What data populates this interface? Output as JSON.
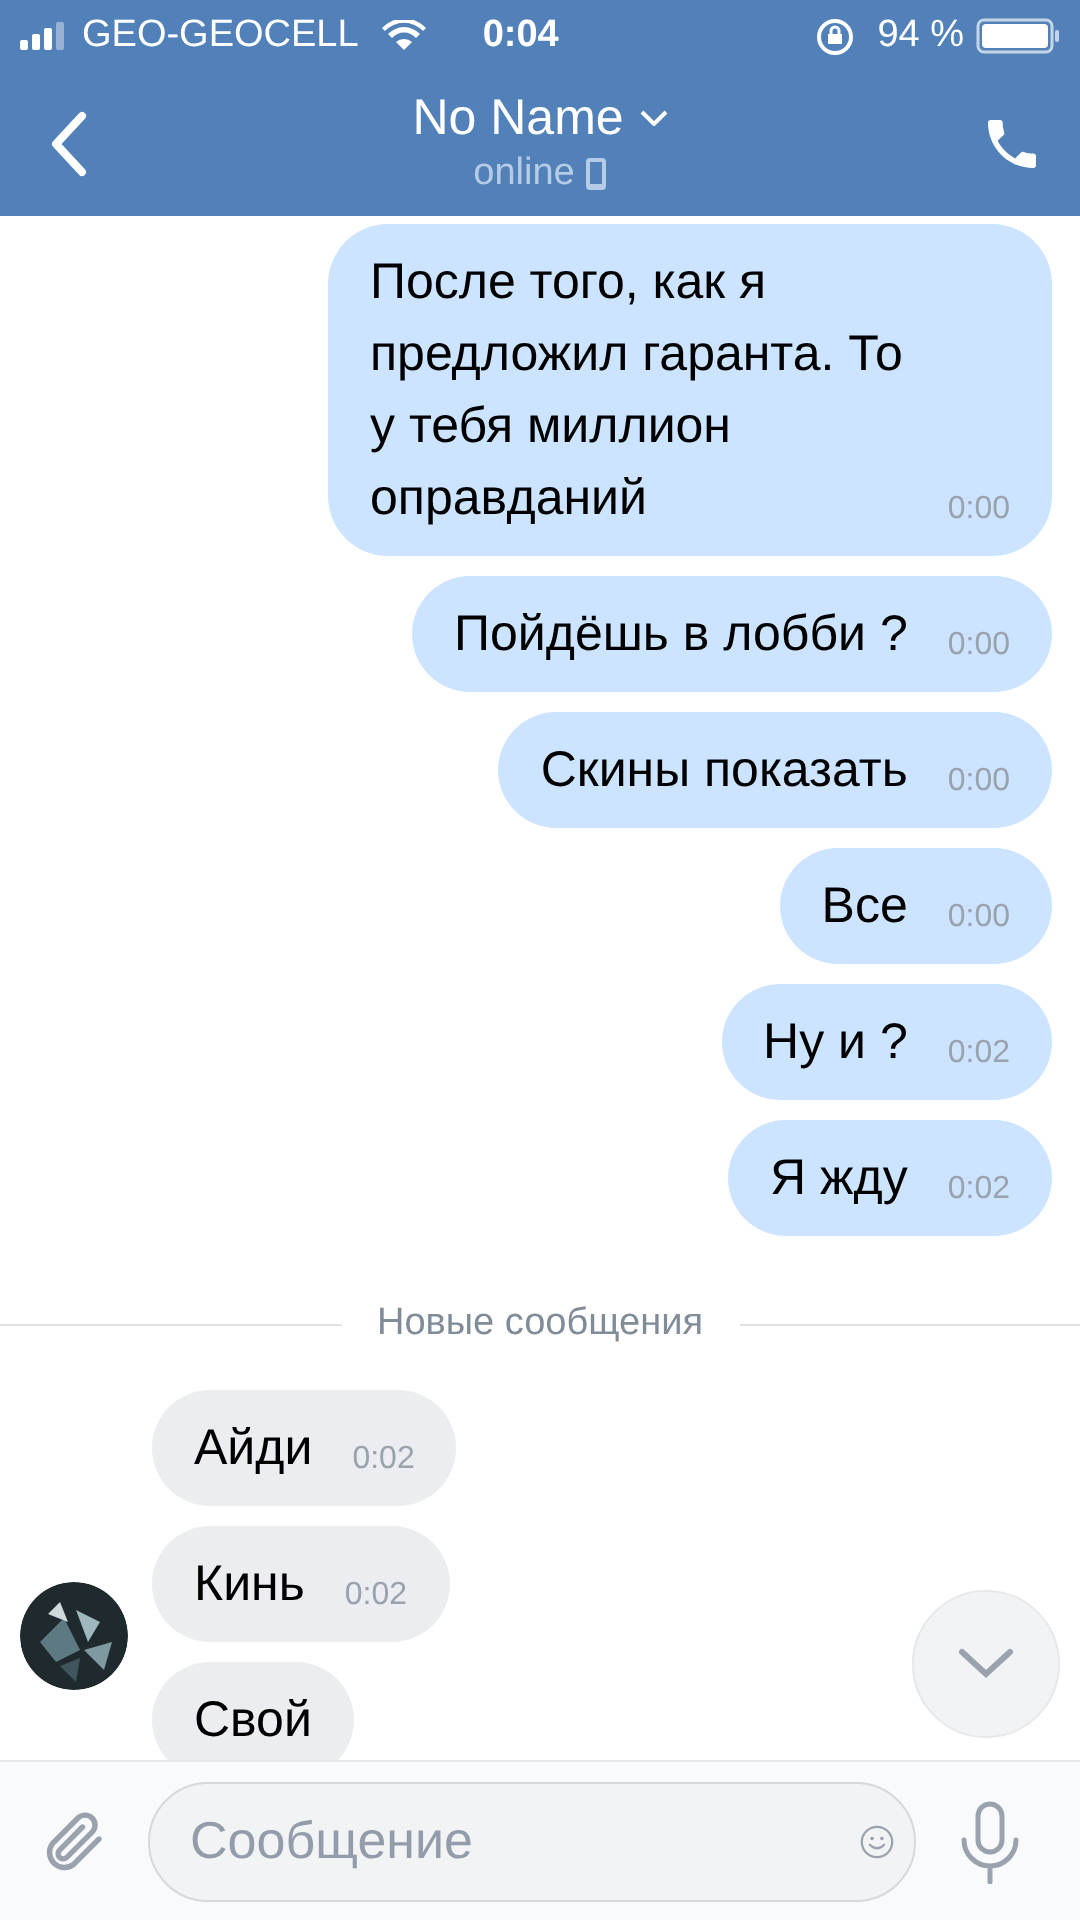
{
  "status_bar": {
    "carrier": "GEO-GEOCELL",
    "time": "0:04",
    "battery": "94 %"
  },
  "header": {
    "title": "No Name",
    "subtitle": "online"
  },
  "messages": [
    {
      "kind": "outgoing",
      "text": "После того, как я предложил гаранта. То у тебя миллион оправданий",
      "time": "0:00"
    },
    {
      "kind": "outgoing",
      "text": "Пойдёшь в лобби ?",
      "time": "0:00"
    },
    {
      "kind": "outgoing",
      "text": "Скины показать",
      "time": "0:00"
    },
    {
      "kind": "outgoing",
      "text": "Все",
      "time": "0:00"
    },
    {
      "kind": "outgoing",
      "text": "Ну и ?",
      "time": "0:02"
    },
    {
      "kind": "outgoing",
      "text": "Я жду",
      "time": "0:02"
    },
    {
      "kind": "divider",
      "text": "Новые сообщения"
    },
    {
      "kind": "incoming",
      "text": "Айди",
      "time": "0:02",
      "avatar": false
    },
    {
      "kind": "incoming",
      "text": "Кинь",
      "time": "0:02",
      "avatar": true
    },
    {
      "kind": "incoming",
      "text": "Свой",
      "avatar": false
    }
  ],
  "composer": {
    "placeholder": "Сообщение"
  }
}
